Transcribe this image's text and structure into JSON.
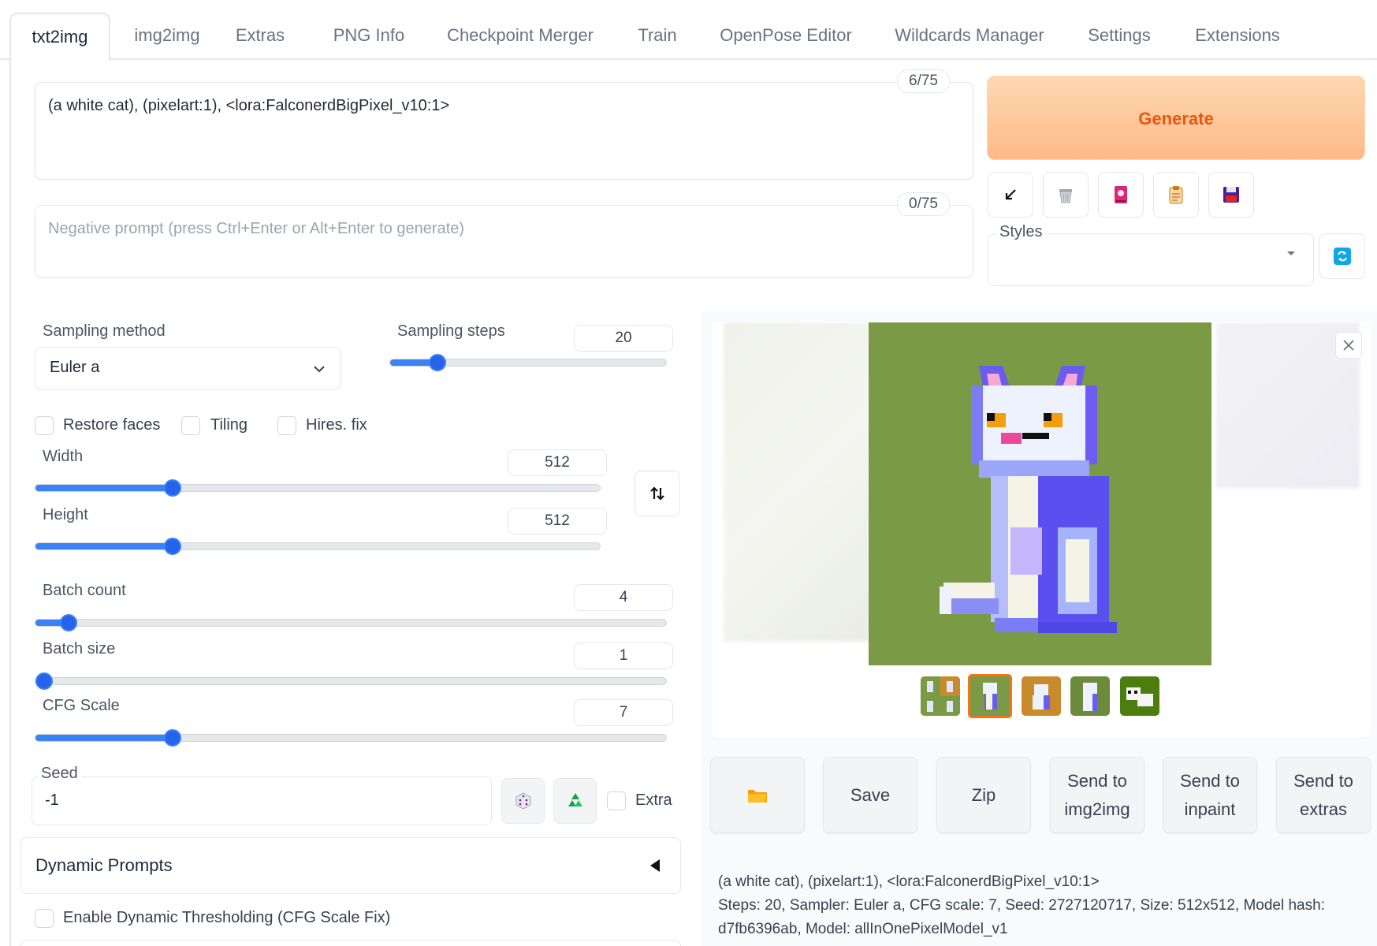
{
  "tabs": [
    "txt2img",
    "img2img",
    "Extras",
    "PNG Info",
    "Checkpoint Merger",
    "Train",
    "OpenPose Editor",
    "Wildcards Manager",
    "Settings",
    "Extensions"
  ],
  "prompt": {
    "value": "(a white cat), (pixelart:1), <lora:FalconerdBigPixel_v10:1>",
    "counter": "6/75"
  },
  "negative_prompt": {
    "placeholder": "Negative prompt (press Ctrl+Enter or Alt+Enter to generate)",
    "counter": "0/75"
  },
  "generate_label": "Generate",
  "styles_label": "Styles",
  "sampling": {
    "method_label": "Sampling method",
    "method_value": "Euler a",
    "steps_label": "Sampling steps",
    "steps_value": "20",
    "steps_fraction": 0.15
  },
  "checkboxes": {
    "restore_faces": "Restore faces",
    "tiling": "Tiling",
    "hires_fix": "Hires. fix"
  },
  "width": {
    "label": "Width",
    "value": "512",
    "fraction": 0.235
  },
  "height": {
    "label": "Height",
    "value": "512",
    "fraction": 0.235
  },
  "batch_count": {
    "label": "Batch count",
    "value": "4",
    "fraction": 0.04
  },
  "batch_size": {
    "label": "Batch size",
    "value": "1",
    "fraction": 0.0
  },
  "cfg_scale": {
    "label": "CFG Scale",
    "value": "7",
    "fraction": 0.21
  },
  "seed": {
    "label": "Seed",
    "value": "-1",
    "extra_label": "Extra"
  },
  "dynamic_prompts_label": "Dynamic Prompts",
  "dynamic_thresholding_label": "Enable Dynamic Thresholding (CFG Scale Fix)",
  "actions": {
    "save": "Save",
    "zip": "Zip",
    "send_img2img_1": "Send to",
    "send_img2img_2": "img2img",
    "send_inpaint_1": "Send to",
    "send_inpaint_2": "inpaint",
    "send_extras_1": "Send to",
    "send_extras_2": "extras"
  },
  "generation_info": {
    "line1": "(a white cat), (pixelart:1), <lora:FalconerdBigPixel_v10:1>",
    "line2": "Steps: 20, Sampler: Euler a, CFG scale: 7, Seed: 2727120717, Size: 512x512, Model hash:",
    "line3": "d7fb6396ab, Model: allInOnePixelModel_v1"
  },
  "colors": {
    "accent": "#3b82f6",
    "generate_text": "#ea580c",
    "generate_bg": "#fdba86",
    "image_bg": "#7a9a45"
  },
  "icons": [
    "arrow-down-left-icon",
    "trash-icon",
    "bookmark-icon",
    "clipboard-icon",
    "floppy-disk-icon",
    "refresh-icon",
    "dice-icon",
    "recycle-icon",
    "folder-icon",
    "swap-icon",
    "close-icon",
    "chevron-down-icon",
    "triangle-left-icon"
  ]
}
